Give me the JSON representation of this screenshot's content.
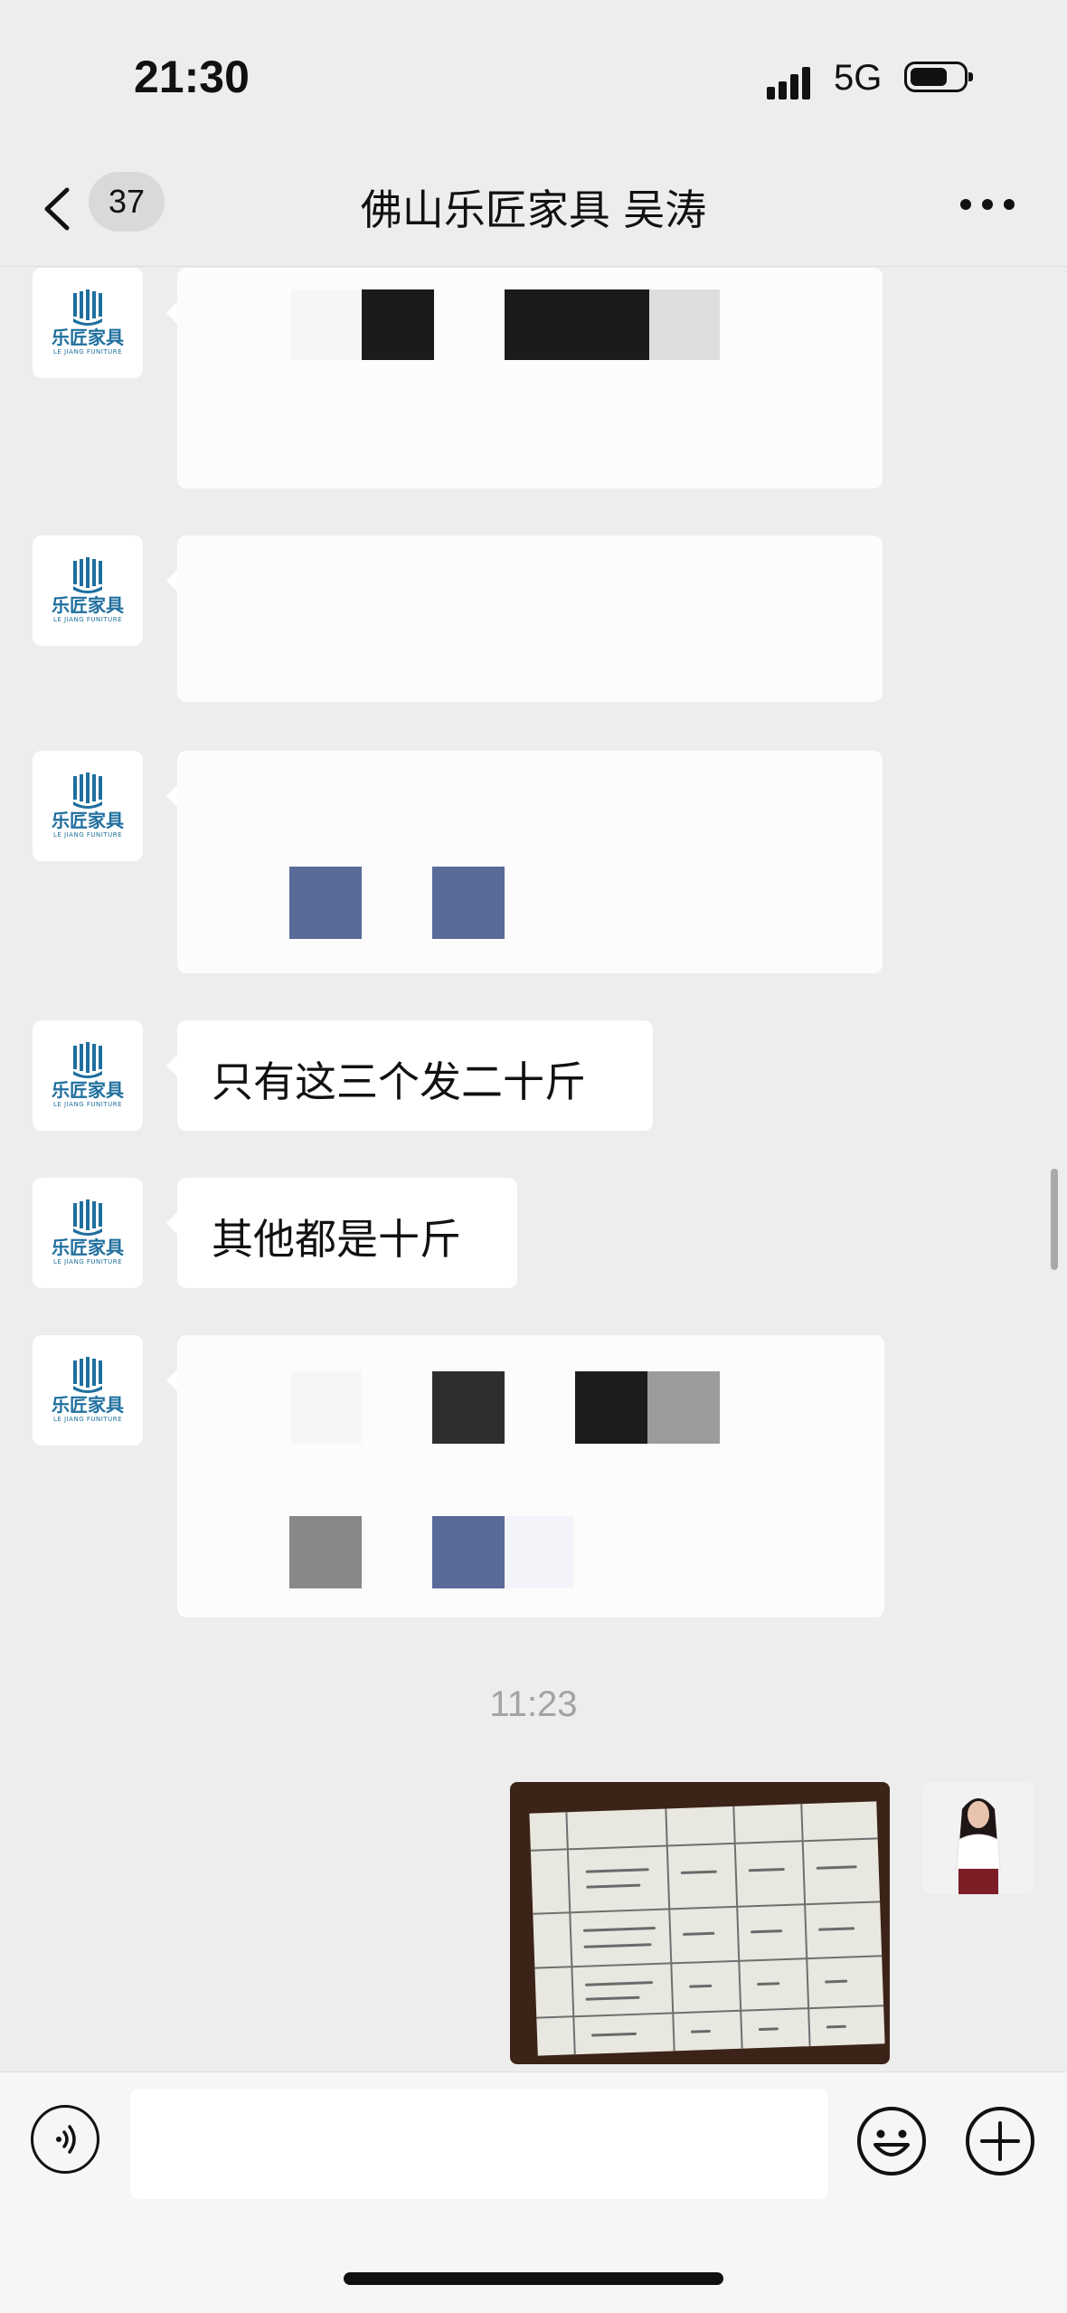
{
  "status_bar": {
    "time": "21:30",
    "network": "5G"
  },
  "nav": {
    "back_count": "37",
    "title": "佛山乐匠家具   吴涛"
  },
  "contact_logo": {
    "cn": "乐匠家具",
    "en": "LE JIANG FUNITURE"
  },
  "messages": [
    {
      "type": "text",
      "text": "只有这三个发二十斤"
    },
    {
      "type": "text",
      "text": "其他都是十斤"
    }
  ],
  "timestamp": "11:23",
  "icons": [
    "back-icon",
    "more-icon",
    "voice-icon",
    "emoji-icon",
    "plus-icon"
  ],
  "colors": {
    "background": "#ededed",
    "bubble": "#ffffff",
    "logo": "#1f6f9e",
    "badge": "#d9d9d9"
  }
}
